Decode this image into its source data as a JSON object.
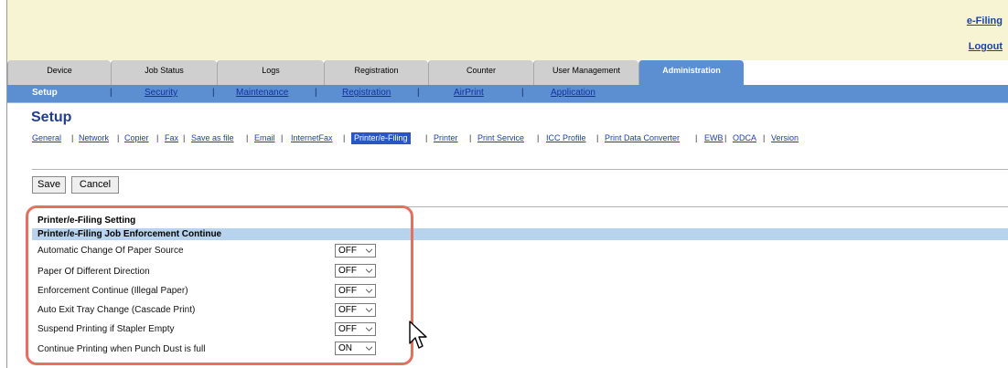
{
  "header": {
    "efiling_link": "e-Filing",
    "logout_link": "Logout"
  },
  "tabs": [
    {
      "label": "Device",
      "active": false
    },
    {
      "label": "Job Status",
      "active": false
    },
    {
      "label": "Logs",
      "active": false
    },
    {
      "label": "Registration",
      "active": false
    },
    {
      "label": "Counter",
      "active": false
    },
    {
      "label": "User Management",
      "active": false
    },
    {
      "label": "Administration",
      "active": true
    }
  ],
  "subnav": [
    {
      "label": "Setup",
      "active": true
    },
    {
      "label": "Security",
      "active": false
    },
    {
      "label": "Maintenance",
      "active": false
    },
    {
      "label": "Registration",
      "active": false
    },
    {
      "label": "AirPrint",
      "active": false
    },
    {
      "label": "Application",
      "active": false
    }
  ],
  "page_title": "Setup",
  "setup_links": [
    {
      "label": "General",
      "active": false
    },
    {
      "label": "Network",
      "active": false
    },
    {
      "label": "Copier",
      "active": false
    },
    {
      "label": "Fax",
      "active": false
    },
    {
      "label": "Save as file",
      "active": false
    },
    {
      "label": "Email",
      "active": false
    },
    {
      "label": "InternetFax",
      "active": false
    },
    {
      "label": "Printer/e-Filing",
      "active": true
    },
    {
      "label": "Printer",
      "active": false
    },
    {
      "label": "Print Service",
      "active": false
    },
    {
      "label": "ICC Profile",
      "active": false
    },
    {
      "label": "Print Data Converter",
      "active": false
    },
    {
      "label": "EWB",
      "active": false
    },
    {
      "label": "ODCA",
      "active": false
    },
    {
      "label": "Version",
      "active": false
    }
  ],
  "buttons": {
    "save": "Save",
    "cancel": "Cancel"
  },
  "section": {
    "title": "Printer/e-Filing Setting",
    "group_header": "Printer/e-Filing Job Enforcement Continue",
    "rows": [
      {
        "label": "Automatic Change Of Paper Source",
        "value": "OFF"
      },
      {
        "label": "Paper Of Different Direction",
        "value": "OFF"
      },
      {
        "label": "Enforcement Continue (Illegal Paper)",
        "value": "OFF"
      },
      {
        "label": "Auto Exit Tray Change (Cascade Print)",
        "value": "OFF"
      },
      {
        "label": "Suspend Printing if Stapler Empty",
        "value": "OFF"
      },
      {
        "label": "Continue Printing when Punch Dust is full",
        "value": "ON"
      }
    ]
  },
  "colors": {
    "accent_blue": "#5c8fd1",
    "header_bg": "#f7f4d3",
    "link": "#1c3fb0",
    "highlight": "#e4715e"
  }
}
